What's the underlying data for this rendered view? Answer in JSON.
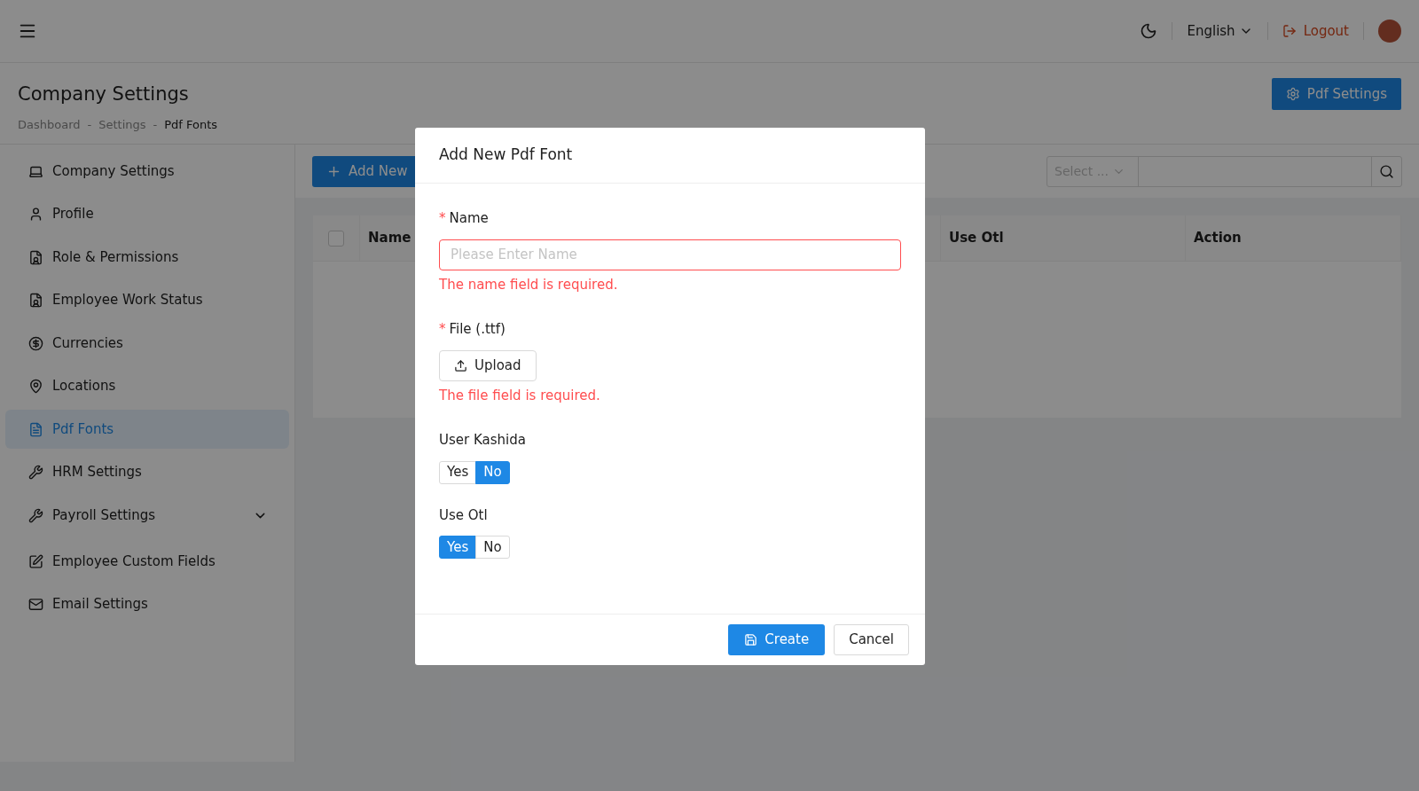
{
  "topbar": {
    "language": "English",
    "logout": "Logout"
  },
  "header": {
    "title": "Company Settings",
    "breadcrumbs": [
      "Dashboard",
      "Settings",
      "Pdf Fonts"
    ],
    "separator": "-",
    "action": "Pdf Settings"
  },
  "sidebar": {
    "items": [
      {
        "label": "Company Settings",
        "selected": false
      },
      {
        "label": "Profile",
        "selected": false
      },
      {
        "label": "Role & Permissions",
        "selected": false
      },
      {
        "label": "Employee Work Status",
        "selected": false
      },
      {
        "label": "Currencies",
        "selected": false
      },
      {
        "label": "Locations",
        "selected": false
      },
      {
        "label": "Pdf Fonts",
        "selected": true
      },
      {
        "label": "HRM Settings",
        "selected": false
      },
      {
        "label": "Payroll Settings",
        "selected": false,
        "has_submenu": true
      },
      {
        "label": "Employee Custom Fields",
        "selected": false
      },
      {
        "label": "Email Settings",
        "selected": false
      }
    ]
  },
  "toolbar": {
    "add_button": "Add New",
    "select": {
      "placeholder": "Select ..."
    }
  },
  "table": {
    "select_all_checked": false,
    "columns": [
      "Name",
      "Use Otl",
      "Action"
    ]
  },
  "modal": {
    "title": "Add New Pdf Font",
    "fields": [
      {
        "kind": "text",
        "label": "Name",
        "required_mark": "*",
        "placeholder": "Please Enter Name",
        "error": "The name field is required."
      },
      {
        "kind": "upload",
        "label": "File (.ttf)",
        "required_mark": "*",
        "button": "Upload",
        "error": "The file field is required."
      },
      {
        "kind": "toggle",
        "label": "User Kashida",
        "options": [
          {
            "label": "Yes",
            "selected": false
          },
          {
            "label": "No",
            "selected": true
          }
        ]
      },
      {
        "kind": "toggle",
        "label": "Use Otl",
        "options": [
          {
            "label": "Yes",
            "selected": true
          },
          {
            "label": "No",
            "selected": false
          }
        ]
      }
    ],
    "buttons": {
      "primary": "Create",
      "secondary": "Cancel"
    }
  }
}
